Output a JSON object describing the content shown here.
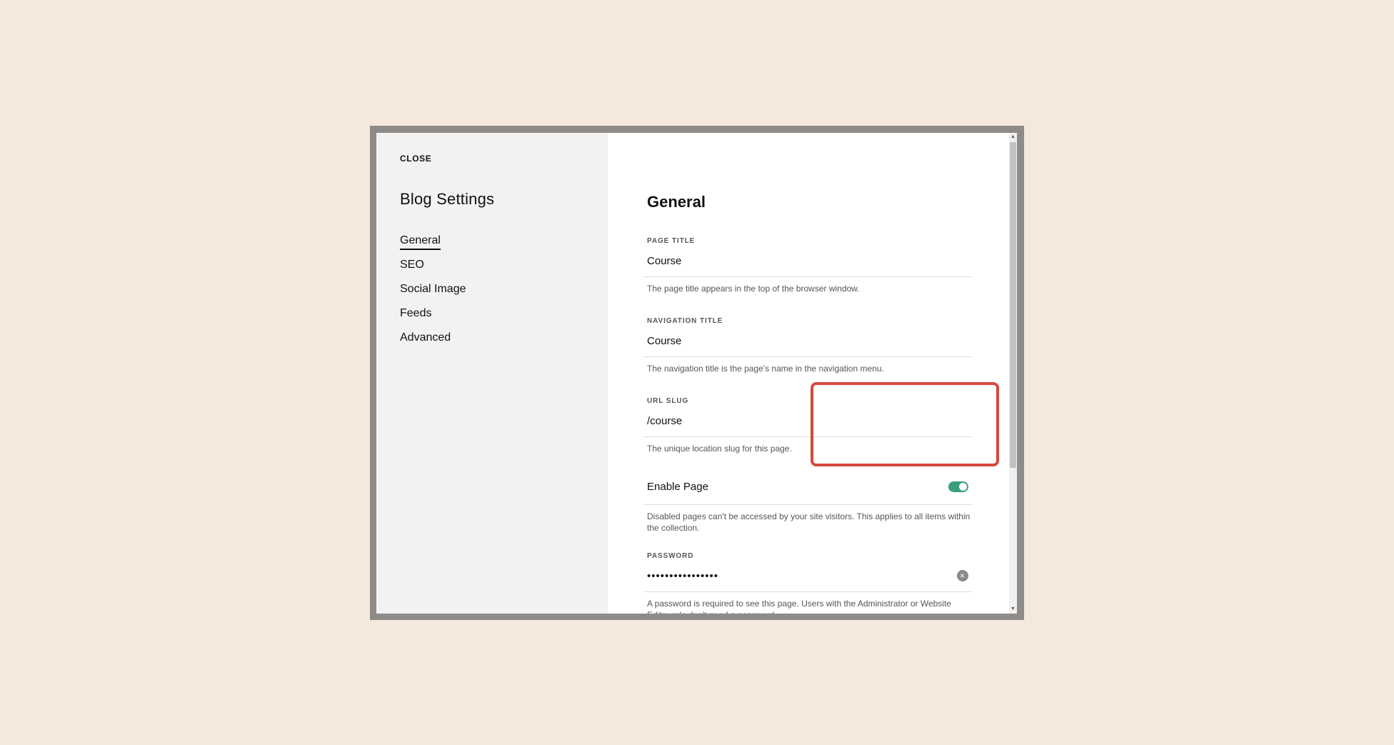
{
  "sidebar": {
    "close_label": "CLOSE",
    "title": "Blog Settings",
    "items": [
      {
        "label": "General",
        "active": true
      },
      {
        "label": "SEO"
      },
      {
        "label": "Social Image"
      },
      {
        "label": "Feeds"
      },
      {
        "label": "Advanced"
      }
    ]
  },
  "main": {
    "section_title": "General",
    "page_title": {
      "label": "PAGE TITLE",
      "value": "Course",
      "help": "The page title appears in the top of the browser window."
    },
    "navigation_title": {
      "label": "NAVIGATION TITLE",
      "value": "Course",
      "help": "The navigation title is the page's name in the navigation menu."
    },
    "url_slug": {
      "label": "URL SLUG",
      "value": "/course",
      "help": "The unique location slug for this page."
    },
    "enable_page": {
      "label": "Enable Page",
      "enabled": true,
      "help": "Disabled pages can't be accessed by your site visitors. This applies to all items within the collection."
    },
    "password": {
      "label": "PASSWORD",
      "value": "••••••••••••••••",
      "help": "A password is required to see this page. Users with the Administrator or Website Editor role don't need a password."
    }
  },
  "colors": {
    "background": "#f5e9de",
    "toggle_on": "#3b9e7d",
    "highlight": "#d6483f"
  }
}
